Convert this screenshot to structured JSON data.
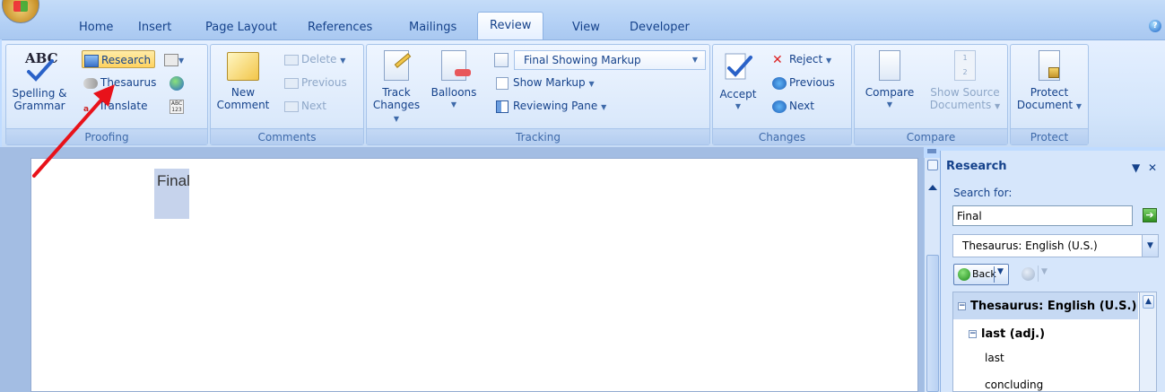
{
  "tabs": [
    "Home",
    "Insert",
    "Page Layout",
    "References",
    "Mailings",
    "Review",
    "View",
    "Developer"
  ],
  "active_tab": "Review",
  "groups": {
    "proofing": {
      "label": "Proofing",
      "spelling_line1": "Spelling &",
      "spelling_line2": "Grammar",
      "abc_glyph": "ABC",
      "research": "Research",
      "thesaurus": "Thesaurus",
      "translate": "Translate"
    },
    "comments": {
      "label": "Comments",
      "new_line1": "New",
      "new_line2": "Comment",
      "delete": "Delete",
      "previous": "Previous",
      "next": "Next"
    },
    "tracking": {
      "label": "Tracking",
      "track_line1": "Track",
      "track_line2": "Changes",
      "balloons": "Balloons",
      "display_for_review": "Final Showing Markup",
      "show_markup": "Show Markup",
      "reviewing_pane": "Reviewing Pane"
    },
    "changes": {
      "label": "Changes",
      "accept": "Accept",
      "reject": "Reject",
      "previous": "Previous",
      "next": "Next"
    },
    "compare": {
      "label": "Compare",
      "compare": "Compare",
      "show_source_line1": "Show Source",
      "show_source_line2": "Documents"
    },
    "protect": {
      "label": "Protect",
      "protect_line1": "Protect",
      "protect_line2": "Document"
    }
  },
  "document": {
    "selected_word": "Final"
  },
  "research_pane": {
    "title": "Research",
    "search_label": "Search for:",
    "search_value": "Final",
    "source": "Thesaurus: English (U.S.)",
    "back": "Back",
    "results": {
      "header": "Thesaurus: English (U.S.)",
      "entry": "last (adj.)",
      "synonyms": [
        "last",
        "concluding"
      ]
    }
  },
  "colors": {
    "ribbon_text": "#15428b",
    "annotation_arrow": "#e8121a"
  }
}
